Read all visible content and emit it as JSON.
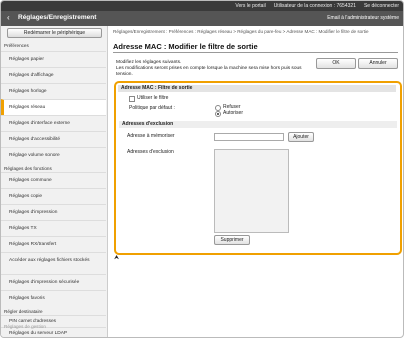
{
  "topbar": {
    "portal_link": "Vers le portail",
    "login_user": "Utilisateur de la connexion : 7654321",
    "logout": "Se déconnecter"
  },
  "titlebar": {
    "title": "Réglages/Enregistrement",
    "mail": "Email à l'administrateur système"
  },
  "sidebar": {
    "restart_button": "Redémarrer le périphérique",
    "preferences_heading": "Préférences",
    "items": [
      "Réglages papier",
      "Réglages d'affichage",
      "Réglages horloge",
      "Réglages réseau",
      "Réglages d'interface externe",
      "Réglages d'accessibilité",
      "Réglage volume sonore"
    ],
    "functions_heading": "Réglages des fonctions",
    "function_items": [
      "Réglages commune",
      "Réglages copie",
      "Réglages d'impression",
      "Réglages TX",
      "Réglages RX/transfert",
      "Accéder aux réglages fichiers stockés",
      "Réglages d'impression sécurisée",
      "Réglages favoris"
    ],
    "dest_heading": "Régler destinataire",
    "dest_items": [
      "PIN carnet d'adresses",
      "Réglages du serveur LDAP"
    ],
    "mgmt_heading": "Réglages de gestion"
  },
  "main": {
    "breadcrumb": "Réglages/Enregistrement : Préférences : Réglages réseau > Réglages du pare-feu > Adresse MAC : Modifier le filtre de sortie",
    "page_title": "Adresse MAC : Modifier le filtre de sortie",
    "description_line1": "Modifiez les réglages suivants.",
    "description_line2": "Les modifications seront prises en compte lorsque la machine sera mise hors puis sous tension.",
    "ok_button": "OK",
    "cancel_button": "Annuler",
    "panel": {
      "header": "Adresse MAC : Filtre de sortie",
      "use_filter_label": "Utiliser le filtre",
      "default_policy_label": "Politique par défaut :",
      "refuse_label": "Refuser",
      "allow_label": "Autoriser",
      "exception_heading": "Adresses d'exclusion",
      "address_to_store_label": "Adresse à mémoriser",
      "address_to_store_value": "",
      "add_button": "Ajouter",
      "exception_list_label": "Adresses d'exclusion",
      "delete_button": "Supprimer"
    }
  }
}
